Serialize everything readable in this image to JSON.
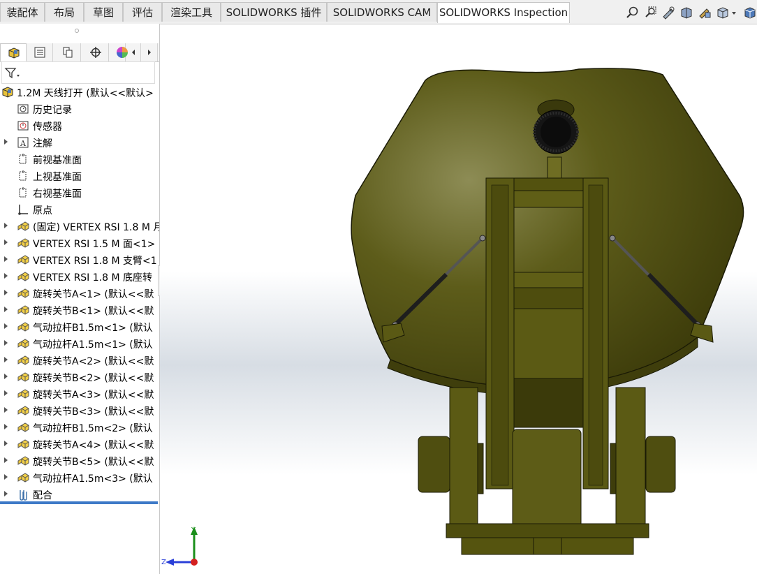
{
  "tabs": [
    {
      "label": "装配体",
      "active": false
    },
    {
      "label": "布局",
      "active": false
    },
    {
      "label": "草图",
      "active": false
    },
    {
      "label": "评估",
      "active": false
    },
    {
      "label": "渲染工具",
      "active": false
    },
    {
      "label": "SOLIDWORKS 插件",
      "active": false
    },
    {
      "label": "SOLIDWORKS CAM",
      "active": false
    },
    {
      "label": "SOLIDWORKS Inspection",
      "active": true
    }
  ],
  "view_toolbar": [
    "zoom-to-fit-icon",
    "zoom-to-area-icon",
    "previous-view-icon",
    "section-view-icon",
    "dynamic-annotation-icon",
    "view-orientation-icon",
    "display-style-icon"
  ],
  "panel_tabs": [
    "featuremanager-tab",
    "propertymanager-tab",
    "configurationmanager-tab",
    "dimxpert-tab",
    "display-manager-tab"
  ],
  "tree": {
    "root": "1.2M 天线打开  (默认<<默认>",
    "items": [
      {
        "label": "历史记录",
        "icon": "history-icon",
        "expandable": false
      },
      {
        "label": "传感器",
        "icon": "sensor-icon",
        "expandable": false
      },
      {
        "label": "注解",
        "icon": "annotation-icon",
        "expandable": true
      },
      {
        "label": "前视基准面",
        "icon": "plane-icon",
        "expandable": false
      },
      {
        "label": "上视基准面",
        "icon": "plane-icon",
        "expandable": false
      },
      {
        "label": "右视基准面",
        "icon": "plane-icon",
        "expandable": false
      },
      {
        "label": "原点",
        "icon": "origin-icon",
        "expandable": false
      },
      {
        "label": "(固定) VERTEX RSI 1.8 M 月",
        "icon": "component-icon",
        "expandable": true
      },
      {
        "label": "VERTEX RSI 1.5 M 面<1>",
        "icon": "component-icon",
        "expandable": true
      },
      {
        "label": "VERTEX RSI 1.8 M 支臂<1",
        "icon": "component-icon",
        "expandable": true
      },
      {
        "label": "VERTEX RSI 1.8 M 底座转",
        "icon": "component-icon",
        "expandable": true
      },
      {
        "label": "旋转关节A<1> (默认<<默",
        "icon": "component-icon",
        "expandable": true
      },
      {
        "label": "旋转关节B<1> (默认<<默",
        "icon": "component-icon",
        "expandable": true
      },
      {
        "label": "气动拉杆B1.5m<1> (默认",
        "icon": "component-icon",
        "expandable": true
      },
      {
        "label": "气动拉杆A1.5m<1> (默认",
        "icon": "component-icon",
        "expandable": true
      },
      {
        "label": "旋转关节A<2> (默认<<默",
        "icon": "component-icon",
        "expandable": true
      },
      {
        "label": "旋转关节B<2> (默认<<默",
        "icon": "component-icon",
        "expandable": true
      },
      {
        "label": "旋转关节A<3> (默认<<默",
        "icon": "component-icon",
        "expandable": true
      },
      {
        "label": "旋转关节B<3> (默认<<默",
        "icon": "component-icon",
        "expandable": true
      },
      {
        "label": "气动拉杆B1.5m<2> (默认",
        "icon": "component-icon",
        "expandable": true
      },
      {
        "label": "旋转关节A<4> (默认<<默",
        "icon": "component-icon",
        "expandable": true
      },
      {
        "label": "旋转关节B<5> (默认<<默",
        "icon": "component-icon",
        "expandable": true
      },
      {
        "label": "气动拉杆A1.5m<3> (默认",
        "icon": "component-icon",
        "expandable": true
      },
      {
        "label": "配合",
        "icon": "mates-icon",
        "expandable": true
      }
    ]
  },
  "triad": {
    "y_label": "Y",
    "z_label": "Z"
  },
  "colors": {
    "accent": "#3d79c7",
    "model_body": "#5b5a14",
    "model_dark": "#2f2e08",
    "model_edge": "#1a1a05"
  }
}
